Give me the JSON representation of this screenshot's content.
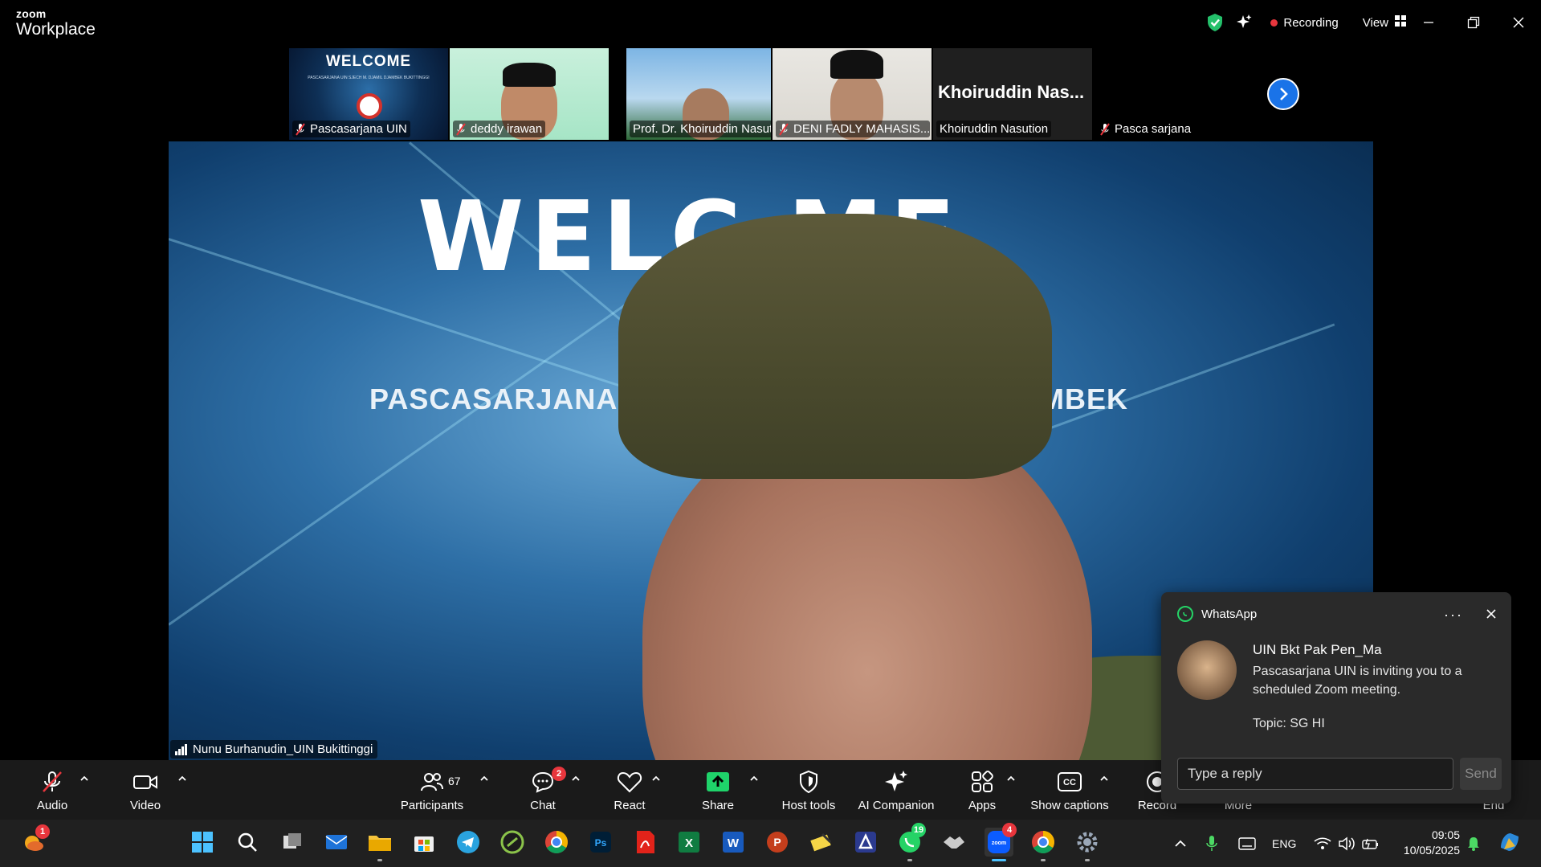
{
  "titlebar": {
    "brand_top": "zoom",
    "brand_bottom": "Workplace",
    "recording_label": "Recording",
    "view_label": "View",
    "icons": [
      "shield-check-icon",
      "sparkle-icon",
      "grid-icon",
      "minimize-icon",
      "restore-icon",
      "close-icon"
    ]
  },
  "thumbnails": [
    {
      "name": "Pascasarjana UIN",
      "muted": true,
      "welcome": "WELCOME",
      "sub": "PASCASARJANA UIN SJECH M. DJAMIL DJAMBEK BUKITTINGGI"
    },
    {
      "name": "deddy irawan",
      "muted": true
    },
    {
      "name": "Prof. Dr. Khoiruddin Nasut...",
      "muted": false
    },
    {
      "name": "DENI FADLY MAHASIS...",
      "muted": true
    },
    {
      "name": "Khoiruddin Nasution",
      "muted": false,
      "avatar_text": "Khoiruddin Nas..."
    },
    {
      "name": "Pasca sarjana",
      "muted": true
    }
  ],
  "main_video": {
    "speaker": "Nunu Burhanudin_UIN Bukittinggi",
    "bg_title": "WELC  ME",
    "bg_line_left": "PASCASARJANA",
    "bg_line_right": "EMBEK"
  },
  "toolbar": {
    "audio": "Audio",
    "video": "Video",
    "participants": "Participants",
    "participants_count": "67",
    "chat": "Chat",
    "chat_badge": "2",
    "react": "React",
    "share": "Share",
    "host_tools": "Host tools",
    "ai_companion": "AI Companion",
    "apps": "Apps",
    "show_captions": "Show captions",
    "record": "Record",
    "more": "More",
    "end": "End"
  },
  "notification": {
    "app": "WhatsApp",
    "sender": "UIN Bkt Pak Pen_Ma",
    "message": "Pascasarjana UIN is inviting you to a scheduled Zoom meeting.",
    "topic": "Topic: SG HI",
    "reply_placeholder": "Type a reply",
    "send": "Send"
  },
  "taskbar": {
    "weather_badge": "1",
    "whatsapp_badge": "19",
    "zoom_badge": "4",
    "lang": "ENG",
    "time": "09:05",
    "date": "10/05/2025"
  },
  "colors": {
    "accent_blue": "#1a73e8",
    "record_red": "#e8363d",
    "share_green": "#1fd36a",
    "whatsapp_green": "#25d366"
  }
}
